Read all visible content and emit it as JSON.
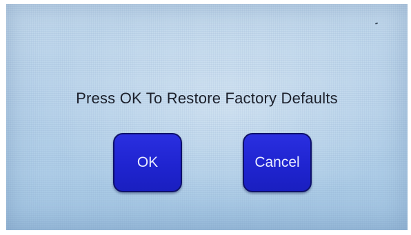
{
  "dialog": {
    "message": "Press OK To Restore Factory Defaults",
    "ok_label": "OK",
    "cancel_label": "Cancel"
  },
  "colors": {
    "screen_background": "#b9d3ea",
    "button_fill": "#1f24d0",
    "button_border": "#0e116a",
    "button_text": "#e9ecff",
    "message_text": "#1b1f2a"
  }
}
